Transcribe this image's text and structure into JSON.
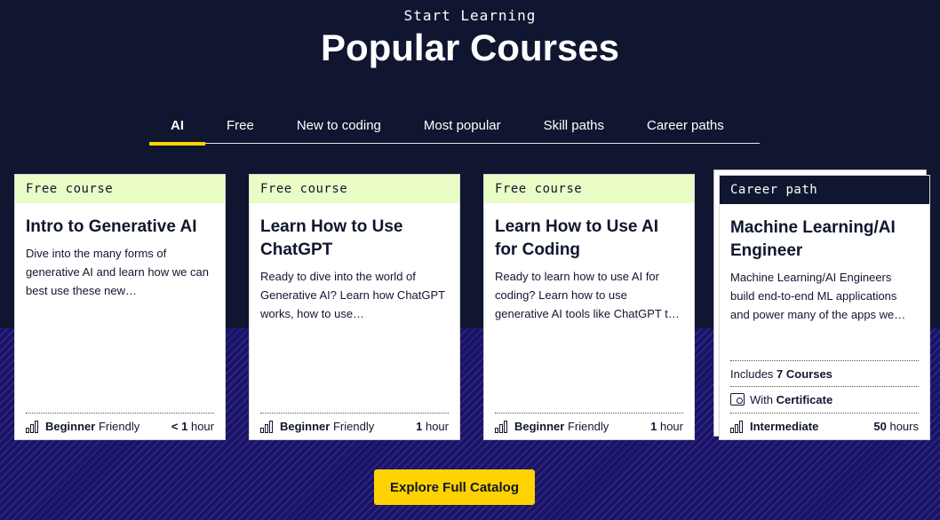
{
  "header": {
    "eyebrow": "Start Learning",
    "title": "Popular Courses"
  },
  "tabs": [
    {
      "label": "AI",
      "active": true
    },
    {
      "label": "Free"
    },
    {
      "label": "New to coding"
    },
    {
      "label": "Most popular"
    },
    {
      "label": "Skill paths"
    },
    {
      "label": "Career paths"
    }
  ],
  "cards": [
    {
      "tag": "Free course",
      "title": "Intro to Generative AI",
      "desc": "Dive into the many forms of generative AI and learn how we can best use these new…",
      "level_bold": "Beginner",
      "level_rest": "Friendly",
      "duration_bold": "< 1",
      "duration_rest": "hour"
    },
    {
      "tag": "Free course",
      "title": "Learn How to Use ChatGPT",
      "desc": "Ready to dive into the world of Generative AI? Learn how ChatGPT works, how to use…",
      "level_bold": "Beginner",
      "level_rest": "Friendly",
      "duration_bold": "1",
      "duration_rest": "hour"
    },
    {
      "tag": "Free course",
      "title": "Learn How to Use AI for Coding",
      "desc": "Ready to learn how to use AI for coding? Learn how to use generative AI tools like ChatGPT t…",
      "level_bold": "Beginner",
      "level_rest": "Friendly",
      "duration_bold": "1",
      "duration_rest": "hour"
    },
    {
      "tag": "Career path",
      "title": "Machine Learning/AI Engineer",
      "desc": "Machine Learning/AI Engineers build end-to-end ML applications and power many of the apps we…",
      "includes_prefix": "Includes",
      "includes_bold": "7 Courses",
      "cert_prefix": "With",
      "cert_bold": "Certificate",
      "level_bold": "Intermediate",
      "duration_bold": "50",
      "duration_rest": "hours"
    }
  ],
  "cta": {
    "label": "Explore Full Catalog"
  },
  "colors": {
    "navy": "#10162f",
    "yellow": "#ffd300",
    "tag_green": "#eafdc6",
    "purple": "#1a1466"
  },
  "icons": {
    "level": "bar-chart-icon",
    "certificate": "certificate-icon"
  }
}
